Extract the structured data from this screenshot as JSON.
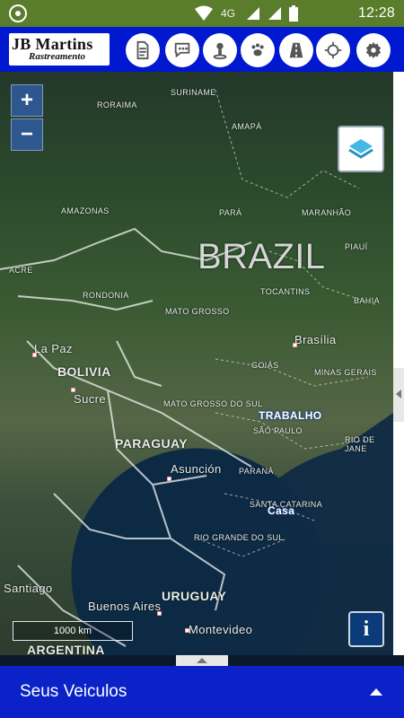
{
  "statusbar": {
    "network": "4G",
    "time": "12:28"
  },
  "header": {
    "logo_title": "JB Martins",
    "logo_subtitle": "Rastreamento"
  },
  "toolbar": {
    "buttons": [
      {
        "icon": "document-icon"
      },
      {
        "icon": "chat-icon"
      },
      {
        "icon": "person-pin-icon"
      },
      {
        "icon": "paw-icon"
      },
      {
        "icon": "road-icon"
      },
      {
        "icon": "crosshair-icon"
      },
      {
        "icon": "gear-icon"
      }
    ]
  },
  "map": {
    "zoom_in": "+",
    "zoom_out": "−",
    "scale": "1000 km",
    "info": "i",
    "labels": {
      "suriname": "SURINAME",
      "roraima": "RORAIMA",
      "amapa": "AMAPÁ",
      "amazonas": "AMAZONAS",
      "para": "PARÁ",
      "maranhao": "MARANHÃO",
      "piaui": "PIAUÍ",
      "brazil": "BRAZIL",
      "acre": "ACRE",
      "rondonia": "RONDONIA",
      "tocantins": "TOCANTINS",
      "bahia": "BAHIA",
      "mato_grosso": "MATO GROSSO",
      "la_paz": "La Paz",
      "brasilia": "Brasília",
      "bolivia": "BOLIVIA",
      "goias": "GOIÁS",
      "minas_gerais": "MINAS GERAIS",
      "sucre": "Sucre",
      "ms": "MATO GROSSO DO SUL",
      "trabalho": "TRABALHO",
      "sao_paulo": "SÃO PAULO",
      "rio": "RIO DE JANE",
      "paraguay": "PARAGUAY",
      "asuncion": "Asunción",
      "parana": "PARANÁ",
      "santa_catarina": "SANTA CATARINA",
      "casa": "Casa",
      "rio_grande": "RIO GRANDE DO SUL",
      "santiago": "Santiago",
      "buenos_aires": "Buenos Aires",
      "uruguay": "URUGUAY",
      "montevideo": "Montevideo",
      "argentina": "ARGENTINA"
    }
  },
  "bottom": {
    "title": "Seus Veiculos"
  }
}
